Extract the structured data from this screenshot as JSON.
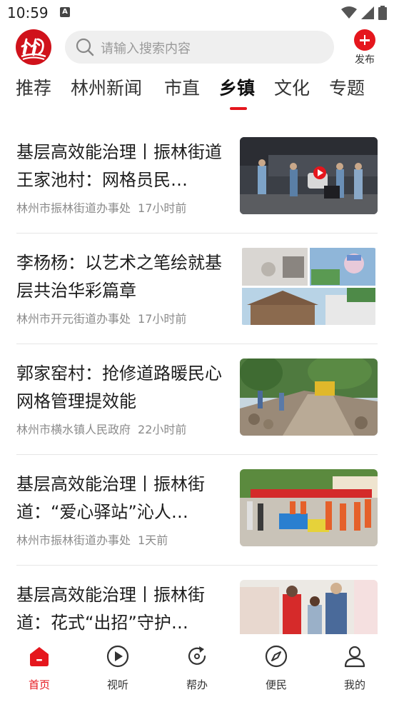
{
  "status_bar": {
    "time": "10:59",
    "notification_letter": "A"
  },
  "header": {
    "search_placeholder": "请输入搜索内容",
    "publish_label": "发布"
  },
  "tabs": [
    "推荐",
    "林州新闻",
    "市直",
    "乡镇",
    "文化",
    "专题"
  ],
  "active_tab": "乡镇",
  "news": [
    {
      "title": "基层高效能治理丨振林街道王家池村：网格员民…",
      "source": "林州市振林街道办事处",
      "time": "17小时前"
    },
    {
      "title": "李杨杨：以艺术之笔绘就基层共治华彩篇章",
      "source": "林州市开元街道办事处",
      "time": "17小时前"
    },
    {
      "title": "郭家窑村：抢修道路暖民心 网格管理提效能",
      "source": "林州市横水镇人民政府",
      "time": "22小时前"
    },
    {
      "title": "基层高效能治理丨振林街道：“爱心驿站”沁人…",
      "source": "林州市振林街道办事处",
      "time": "1天前"
    },
    {
      "title": "基层高效能治理丨振林街道：花式“出招”守护…",
      "source": "",
      "time": ""
    }
  ],
  "bottom_nav": [
    {
      "label": "首页",
      "icon": "home-icon"
    },
    {
      "label": "视听",
      "icon": "play-icon"
    },
    {
      "label": "帮办",
      "icon": "refresh-icon"
    },
    {
      "label": "便民",
      "icon": "compass-icon"
    },
    {
      "label": "我的",
      "icon": "user-icon"
    }
  ],
  "colors": {
    "accent": "#e5161d",
    "logo": "#d0121b",
    "search_bg": "#efefef"
  }
}
